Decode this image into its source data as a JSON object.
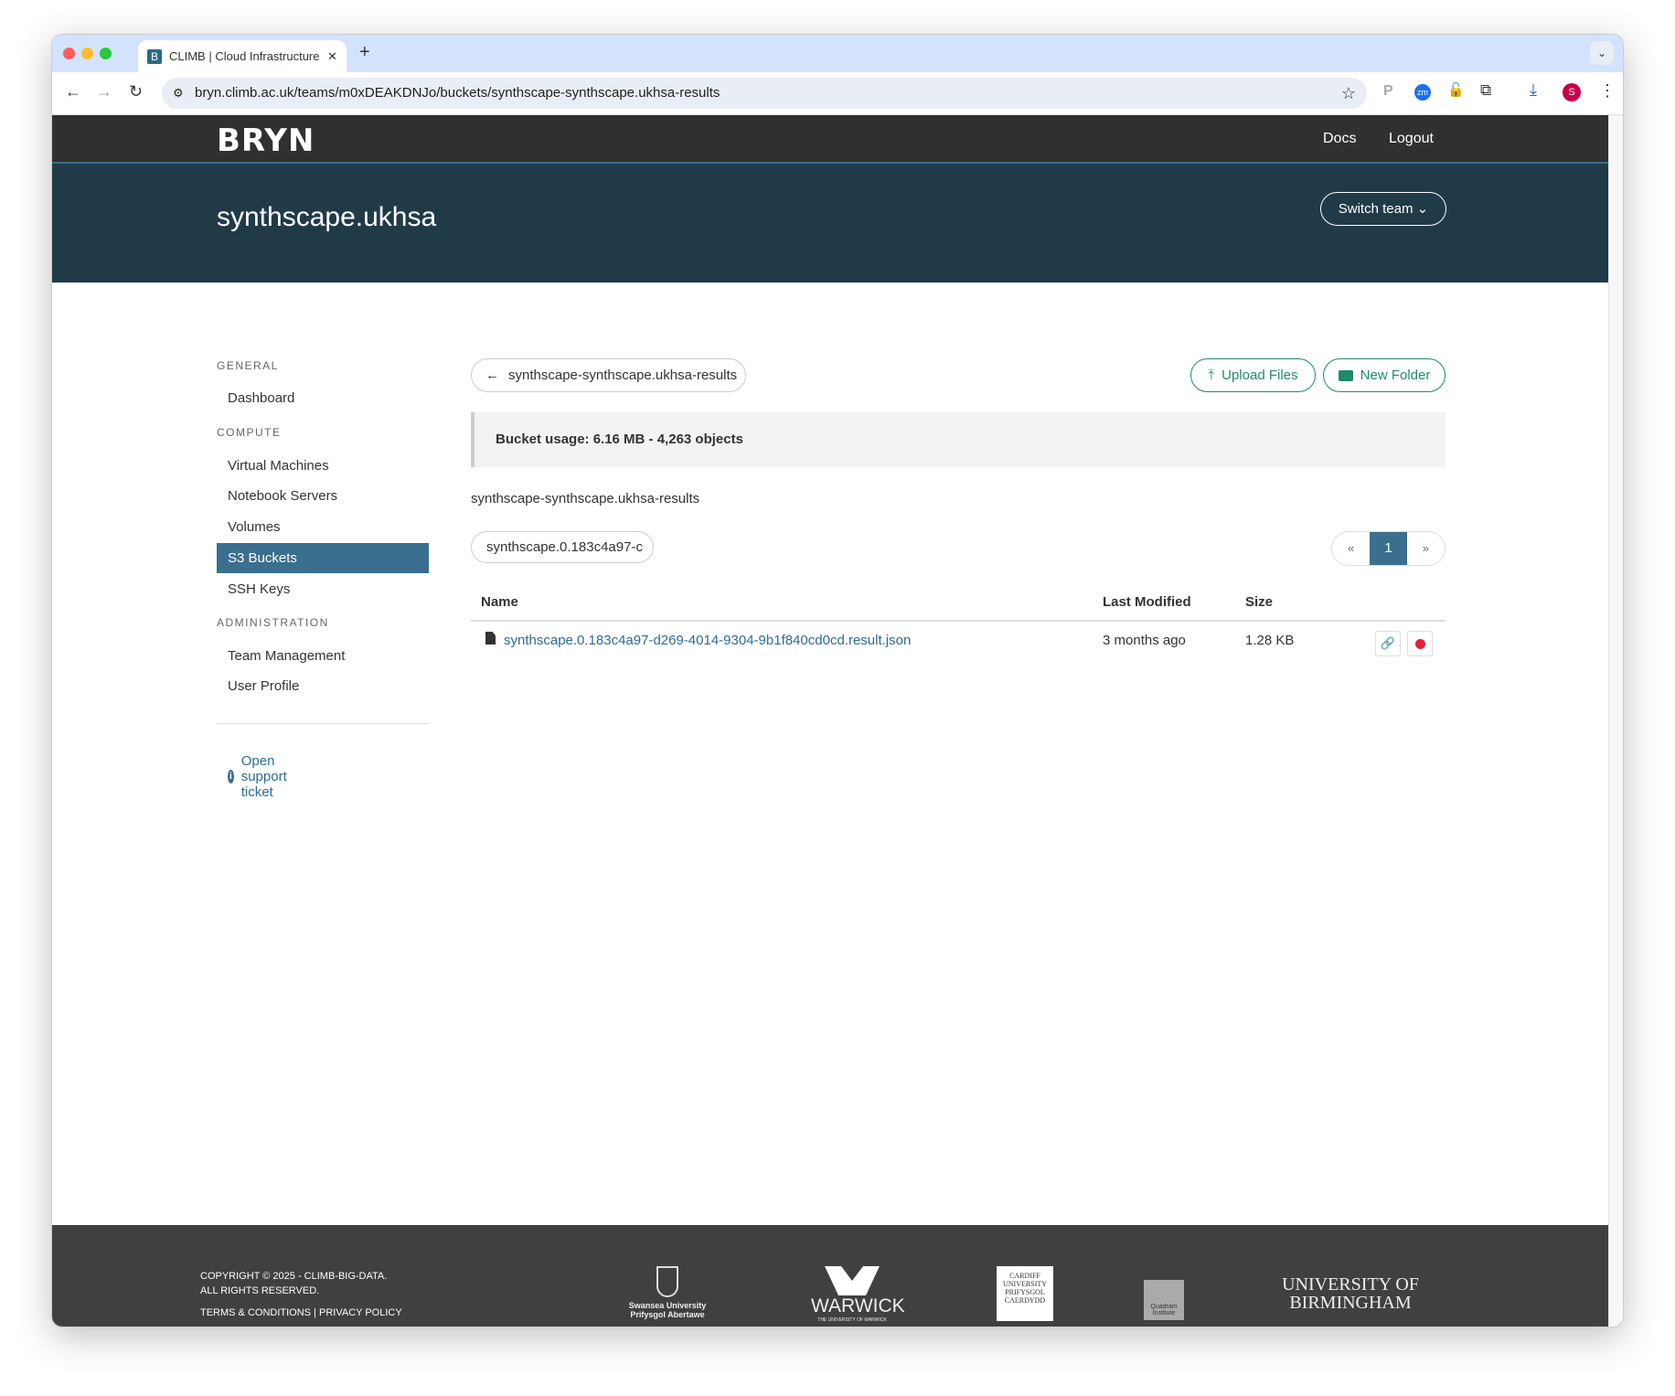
{
  "browser": {
    "tab_title": "CLIMB | Cloud Infrastructure f",
    "favicon": "B",
    "url": "bryn.climb.ac.uk/teams/m0xDEAKDNJo/buckets/synthscape-synthscape.ukhsa-results",
    "profile_initial": "S",
    "ext_zoom": "zm"
  },
  "nav": {
    "logo": "BRYN",
    "docs": "Docs",
    "logout": "Logout"
  },
  "banner": {
    "team": "synthscape.ukhsa",
    "switch_team": "Switch team"
  },
  "sidebar": {
    "general": "GENERAL",
    "dashboard": "Dashboard",
    "compute": "COMPUTE",
    "vms": "Virtual Machines",
    "notebooks": "Notebook Servers",
    "volumes": "Volumes",
    "s3": "S3 Buckets",
    "ssh": "SSH Keys",
    "administration": "ADMINISTRATION",
    "team_mgmt": "Team Management",
    "profile": "User Profile",
    "support": "Open support ticket"
  },
  "main": {
    "back_label": "synthscape-synthscape.ukhsa-results",
    "upload": "Upload Files",
    "new_folder": "New Folder",
    "usage": "Bucket usage: 6.16 MB - 4,263 objects",
    "bucket_name": "synthscape-synthscape.ukhsa-results",
    "prefix_filter": "synthscape.0.183c4a97-c",
    "pagination": {
      "prev": "«",
      "current": "1",
      "next": "»"
    },
    "columns": {
      "name": "Name",
      "modified": "Last Modified",
      "size": "Size"
    },
    "rows": [
      {
        "name": "synthscape.0.183c4a97-d269-4014-9304-9b1f840cd0cd.result.json",
        "modified": "3 months ago",
        "size": "1.28 KB"
      }
    ]
  },
  "footer": {
    "copyright": "COPYRIGHT © 2025 - CLIMB-BIG-DATA.",
    "rights": "ALL RIGHTS RESERVED.",
    "terms": "TERMS & CONDITIONS",
    "sep": "|",
    "privacy": "PRIVACY POLICY",
    "logos": {
      "swansea": "Swansea University Prifysgol Abertawe",
      "warwick": "WARWICK",
      "warwick_sub": "THE UNIVERSITY OF WARWICK",
      "cardiff": "CARDIFF UNIVERSITY PRIFYSGOL CAERDYDD",
      "quadram": "Quadram Institute",
      "birmingham1": "UNIVERSITY OF",
      "birmingham2": "BIRMINGHAM"
    }
  },
  "colors": {
    "accent": "#3a6f8f",
    "green": "#1f8a6b",
    "link": "#2c6a96",
    "nav": "#303030",
    "banner": "#213a48",
    "footer": "#404040",
    "danger": "#e0213a"
  }
}
